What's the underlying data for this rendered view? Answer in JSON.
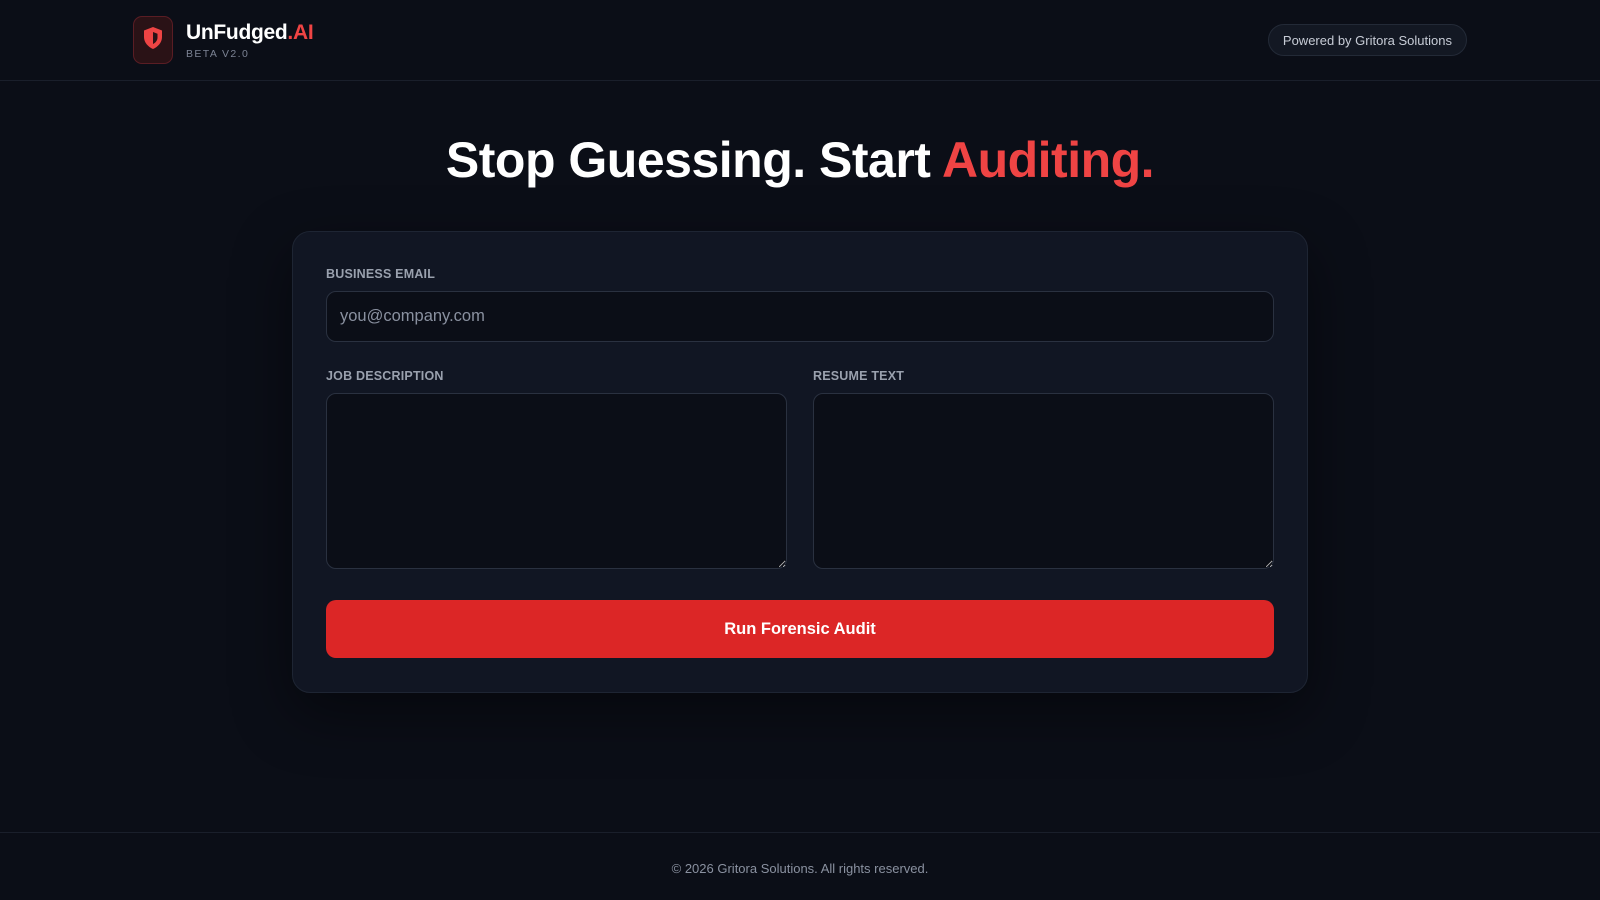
{
  "header": {
    "brand_name": "UnFudged",
    "brand_accent": ".AI",
    "brand_sub": "BETA V2.0",
    "logo_icon": "shield-icon",
    "powered_by": "Powered by Gritora Solutions"
  },
  "hero": {
    "title_main": "Stop Guessing. Start ",
    "title_accent": "Auditing."
  },
  "form": {
    "email_label": "BUSINESS EMAIL",
    "email_placeholder": "you@company.com",
    "email_value": "",
    "job_label": "JOB DESCRIPTION",
    "job_value": "",
    "resume_label": "RESUME TEXT",
    "resume_value": "",
    "submit_label": "Run Forensic Audit"
  },
  "footer": {
    "copyright": "© 2026 Gritora Solutions. All rights reserved."
  },
  "colors": {
    "background": "#0b0e17",
    "card": "#111623",
    "accent": "#ef4444",
    "button": "#dc2626"
  }
}
